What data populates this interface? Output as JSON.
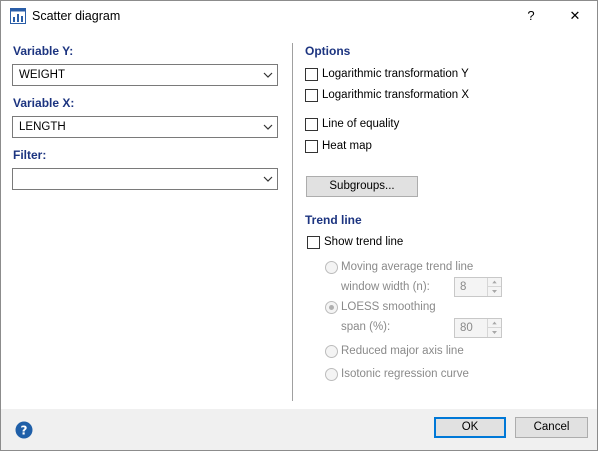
{
  "window": {
    "title": "Scatter diagram",
    "help_glyph": "?",
    "close_glyph": "✕"
  },
  "left": {
    "variable_y_label": "Variable Y:",
    "variable_y_value": "WEIGHT",
    "variable_x_label": "Variable X:",
    "variable_x_value": "LENGTH",
    "filter_label": "Filter:",
    "filter_value": ""
  },
  "options": {
    "heading": "Options",
    "log_y": "Logarithmic transformation Y",
    "log_x": "Logarithmic transformation X",
    "line_of_equality": "Line of equality",
    "heat_map": "Heat map",
    "subgroups_button": "Subgroups..."
  },
  "trend": {
    "heading": "Trend line",
    "show_trend_line": "Show trend line",
    "moving_average": "Moving average trend line",
    "window_width_label": "window width (n):",
    "window_width_value": "8",
    "loess": "LOESS smoothing",
    "span_label": "span (%):",
    "span_value": "80",
    "reduced_major_axis": "Reduced major axis line",
    "isotonic": "Isotonic regression curve"
  },
  "footer": {
    "ok_label": "OK",
    "cancel_label": "Cancel"
  },
  "colors": {
    "section_label": "#1c3480",
    "default_button_border": "#0078d7",
    "help_icon": "#1f5fa8",
    "disabled_text": "#8a8a8a"
  },
  "icons": {
    "app": "chart-icon",
    "help": "help-circle-icon",
    "dropdown": "chevron-down-icon"
  }
}
